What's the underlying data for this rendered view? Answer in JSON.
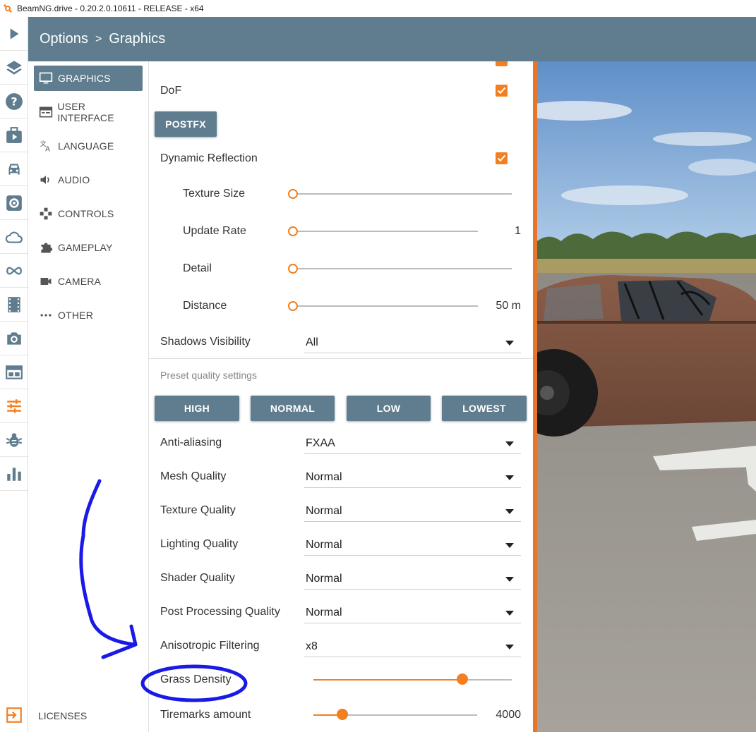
{
  "window": {
    "title": "BeamNG.drive - 0.20.2.0.10611 - RELEASE - x64"
  },
  "header": {
    "section": "Options",
    "separator": ">",
    "page": "Graphics"
  },
  "rail": {
    "icons": [
      "play-icon",
      "layers-icon",
      "help-icon",
      "missions-icon",
      "car-icon",
      "settings-icon",
      "cloud-icon",
      "infinity-icon",
      "film-icon",
      "camera-icon",
      "layout-icon",
      "sliders-icon",
      "bug-icon",
      "chart-icon",
      "exit-icon"
    ]
  },
  "sidenav": {
    "items": [
      {
        "label": "GRAPHICS",
        "icon": "monitor-icon",
        "active": true
      },
      {
        "label": "USER INTERFACE",
        "icon": "window-icon",
        "active": false
      },
      {
        "label": "LANGUAGE",
        "icon": "translate-icon",
        "active": false
      },
      {
        "label": "AUDIO",
        "icon": "speaker-icon",
        "active": false
      },
      {
        "label": "CONTROLS",
        "icon": "gamepad-icon",
        "active": false
      },
      {
        "label": "GAMEPLAY",
        "icon": "puzzle-icon",
        "active": false
      },
      {
        "label": "CAMERA",
        "icon": "videocam-icon",
        "active": false
      },
      {
        "label": "OTHER",
        "icon": "more-icon",
        "active": false
      }
    ],
    "licenses": "LICENSES"
  },
  "settings": {
    "dof": {
      "label": "DoF",
      "checked": true
    },
    "postfx_button": "POSTFX",
    "dynamic_reflection": {
      "label": "Dynamic Reflection",
      "checked": true
    },
    "texture_size": {
      "label": "Texture Size",
      "level": 0
    },
    "update_rate": {
      "label": "Update Rate",
      "value": "1",
      "level": 0
    },
    "detail": {
      "label": "Detail",
      "level": 0
    },
    "distance": {
      "label": "Distance",
      "value": "50 m",
      "level": 0
    },
    "shadows_visibility": {
      "label": "Shadows Visibility",
      "value": "All"
    },
    "preset_label": "Preset quality settings",
    "presets": [
      "HIGH",
      "NORMAL",
      "LOW",
      "LOWEST"
    ],
    "anti_aliasing": {
      "label": "Anti-aliasing",
      "value": "FXAA"
    },
    "mesh_quality": {
      "label": "Mesh Quality",
      "value": "Normal"
    },
    "texture_quality": {
      "label": "Texture Quality",
      "value": "Normal"
    },
    "lighting_quality": {
      "label": "Lighting Quality",
      "value": "Normal"
    },
    "shader_quality": {
      "label": "Shader Quality",
      "value": "Normal"
    },
    "post_processing_quality": {
      "label": "Post Processing Quality",
      "value": "Normal"
    },
    "anisotropic_filtering": {
      "label": "Anisotropic Filtering",
      "value": "x8"
    },
    "grass_density": {
      "label": "Grass Density",
      "level": 0.75
    },
    "tiremarks_amount": {
      "label": "Tiremarks amount",
      "value": "4000",
      "level": 0.18
    }
  },
  "colors": {
    "accent": "#f37f20",
    "header": "#5f7d8e",
    "annotation": "#1a1ae6"
  }
}
